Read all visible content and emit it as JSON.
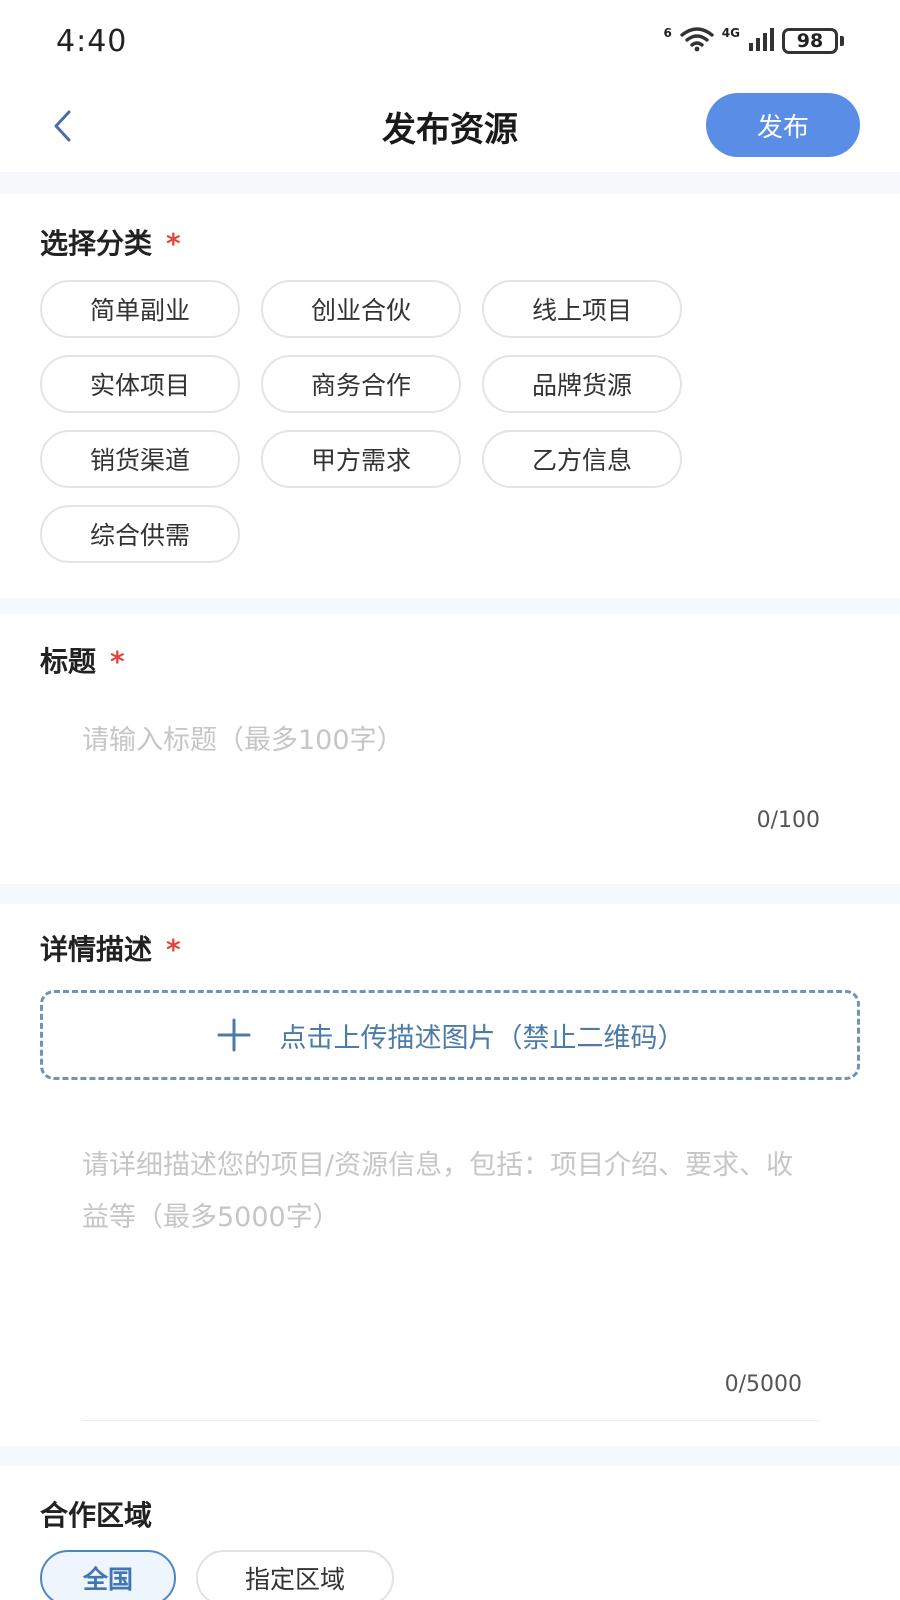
{
  "status_bar": {
    "time": "4:40",
    "network": "4G",
    "wifi_superscript": "6",
    "battery": "98"
  },
  "nav": {
    "title": "发布资源",
    "publish_label": "发布"
  },
  "category": {
    "label": "选择分类",
    "required": "*",
    "options": [
      "简单副业",
      "创业合伙",
      "线上项目",
      "实体项目",
      "商务合作",
      "品牌货源",
      "销货渠道",
      "甲方需求",
      "乙方信息",
      "综合供需"
    ]
  },
  "title_field": {
    "label": "标题",
    "required": "*",
    "placeholder": "请输入标题（最多100字）",
    "value": "",
    "counter": "0/100"
  },
  "description": {
    "label": "详情描述",
    "required": "*",
    "upload_label": "点击上传描述图片（禁止二维码）",
    "placeholder": "请详细描述您的项目/资源信息，包括：项目介绍、要求、收益等（最多5000字）",
    "value": "",
    "counter": "0/5000"
  },
  "region": {
    "label": "合作区域",
    "options": [
      "全国",
      "指定区域"
    ],
    "selected": "全国"
  },
  "colors": {
    "accent": "#5a8de6",
    "required": "#e0473c",
    "upload_border": "#6f94b5",
    "selected_chip": "#4f86c2"
  }
}
